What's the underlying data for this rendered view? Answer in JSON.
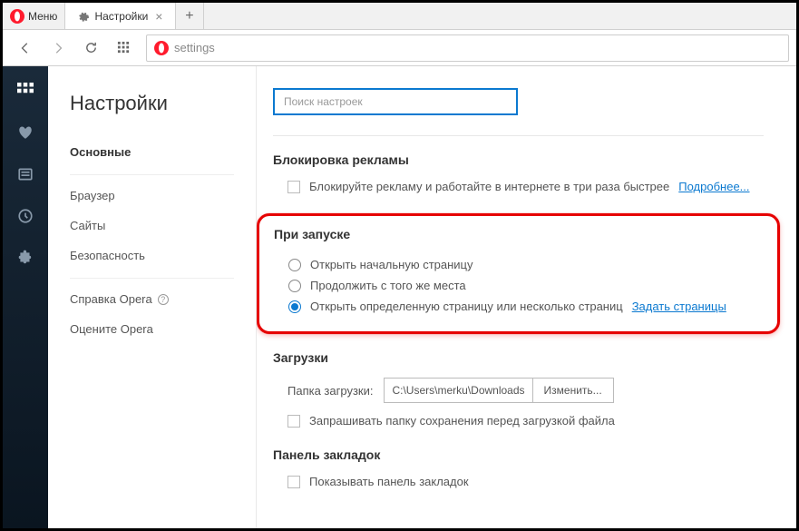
{
  "menu": {
    "label": "Меню"
  },
  "tab": {
    "title": "Настройки"
  },
  "address": {
    "text": "settings"
  },
  "settings": {
    "title": "Настройки",
    "nav": {
      "basic": "Основные",
      "browser": "Браузер",
      "sites": "Сайты",
      "security": "Безопасность",
      "help": "Справка Opera",
      "rate": "Оцените Opera"
    }
  },
  "search": {
    "placeholder": "Поиск настроек"
  },
  "sections": {
    "adblock": {
      "title": "Блокировка рекламы",
      "label": "Блокируйте рекламу и работайте в интернете в три раза быстрее",
      "more": "Подробнее..."
    },
    "startup": {
      "title": "При запуске",
      "opt1": "Открыть начальную страницу",
      "opt2": "Продолжить с того же места",
      "opt3": "Открыть определенную страницу или несколько страниц",
      "set_pages": "Задать страницы"
    },
    "downloads": {
      "title": "Загрузки",
      "folder_label": "Папка загрузки:",
      "folder_value": "C:\\Users\\merku\\Downloads",
      "change": "Изменить...",
      "ask": "Запрашивать папку сохранения перед загрузкой файла"
    },
    "bookmarks": {
      "title": "Панель закладок",
      "show": "Показывать панель закладок"
    }
  }
}
